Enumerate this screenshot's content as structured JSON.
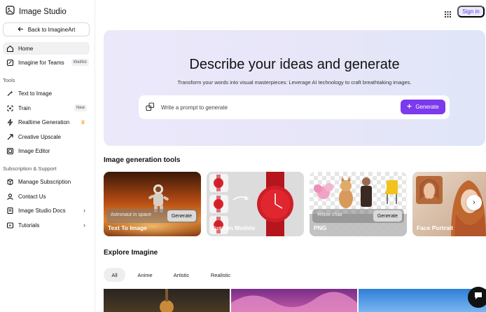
{
  "app": {
    "title": "Image Studio"
  },
  "sidebar": {
    "back_label": "Back to ImagineArt",
    "home": "Home",
    "teams": {
      "label": "Imagine for Teams",
      "badge": "Waitlist"
    },
    "tools_title": "Tools",
    "tools": [
      {
        "label": "Text to Image",
        "icon": "text-image-icon"
      },
      {
        "label": "Train",
        "icon": "train-icon",
        "badge": "New"
      },
      {
        "label": "Realtime Generation",
        "icon": "realtime-icon",
        "badge_icon": "crown-icon"
      },
      {
        "label": "Creative Upscale",
        "icon": "upscale-icon"
      },
      {
        "label": "Image Editor",
        "icon": "editor-icon"
      }
    ],
    "support_title": "Subscription & Support",
    "support": [
      {
        "label": "Manage Subscription",
        "icon": "subscription-icon"
      },
      {
        "label": "Contact Us",
        "icon": "contact-icon"
      },
      {
        "label": "Image Studio Docs",
        "icon": "docs-icon"
      },
      {
        "label": "Tutorials",
        "icon": "tutorials-icon"
      }
    ]
  },
  "topbar": {
    "signin_label": "Sign in"
  },
  "hero": {
    "title": "Describe your ideas and generate",
    "subtitle": "Transform your words into visual masterpieces: Leverage AI technology to craft breathtaking images.",
    "placeholder": "Write a prompt to generate",
    "generate_label": "Generate"
  },
  "tools_section": {
    "title": "Image generation tools",
    "cards": [
      {
        "label": "Text To Image",
        "overlay_text": "Astronaut in space",
        "button": "Generate"
      },
      {
        "label": "Custom Models"
      },
      {
        "label": "PNG",
        "overlay_text": "Yellow chair",
        "button": "Generate"
      },
      {
        "label": "Face Portrait"
      }
    ]
  },
  "explore": {
    "title": "Explore Imagine",
    "tabs": [
      "All",
      "Anime",
      "Artistic",
      "Realistic"
    ],
    "active_tab": "All"
  },
  "colors": {
    "accent": "#7c3aed",
    "signin_bg": "#ece9fb",
    "hero_bg": "#e9e7f9"
  }
}
